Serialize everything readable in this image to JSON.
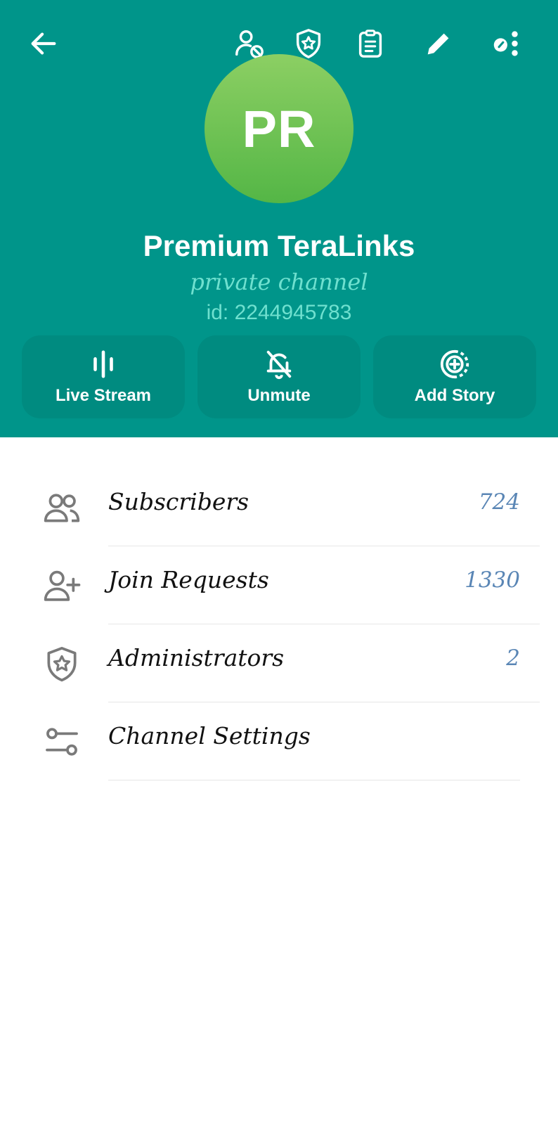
{
  "header": {
    "avatar_initials": "PR",
    "title": "Premium TeraLinks",
    "subtitle": "private channel",
    "id_line": "id: 2244945783",
    "colors": {
      "background": "#00958a",
      "button": "#008b80",
      "accent_text": "#6fe0cf"
    },
    "toolbar": {
      "icons": [
        "back-arrow-icon",
        "user-blocked-icon",
        "shield-star-icon",
        "clipboard-icon",
        "pencil-icon",
        "more-options-icon"
      ]
    }
  },
  "actions": [
    {
      "label": "Live Stream",
      "icon": "live-stream-icon"
    },
    {
      "label": "Unmute",
      "icon": "bell-muted-icon"
    },
    {
      "label": "Add Story",
      "icon": "add-story-icon"
    }
  ],
  "menu": [
    {
      "label": "Subscribers",
      "value": "724",
      "icon": "users-icon"
    },
    {
      "label": "Join Requests",
      "value": "1330",
      "icon": "user-add-icon"
    },
    {
      "label": "Administrators",
      "value": "2",
      "icon": "shield-star-icon"
    },
    {
      "label": "Channel Settings",
      "value": "",
      "icon": "sliders-icon"
    }
  ]
}
